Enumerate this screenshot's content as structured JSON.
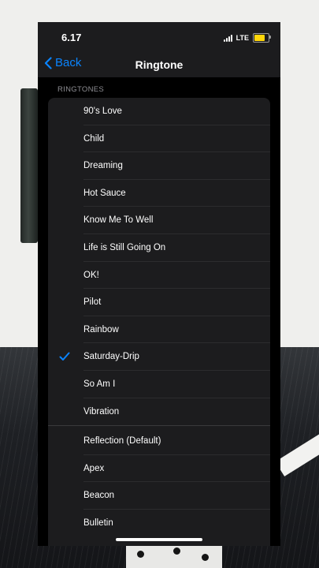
{
  "status_bar": {
    "time": "6.17",
    "network": "LTE",
    "battery_color": "#ffd60a"
  },
  "nav": {
    "back_label": "Back",
    "title": "Ringtone"
  },
  "section": {
    "header": "RINGTONES"
  },
  "ringtones": [
    {
      "label": "90's Love"
    },
    {
      "label": "Child"
    },
    {
      "label": "Dreaming"
    },
    {
      "label": "Hot Sauce"
    },
    {
      "label": "Know Me To Well"
    },
    {
      "label": "Life is Still Going On"
    },
    {
      "label": "OK!"
    },
    {
      "label": "Pilot"
    },
    {
      "label": "Rainbow"
    },
    {
      "label": "Saturday-Drip",
      "selected": true
    },
    {
      "label": "So Am I"
    },
    {
      "label": "Vibration"
    }
  ],
  "system_ringtones": [
    {
      "label": "Reflection (Default)"
    },
    {
      "label": "Apex"
    },
    {
      "label": "Beacon"
    },
    {
      "label": "Bulletin"
    }
  ],
  "colors": {
    "accent": "#0a84ff",
    "screen_bg": "#1c1c1e"
  }
}
